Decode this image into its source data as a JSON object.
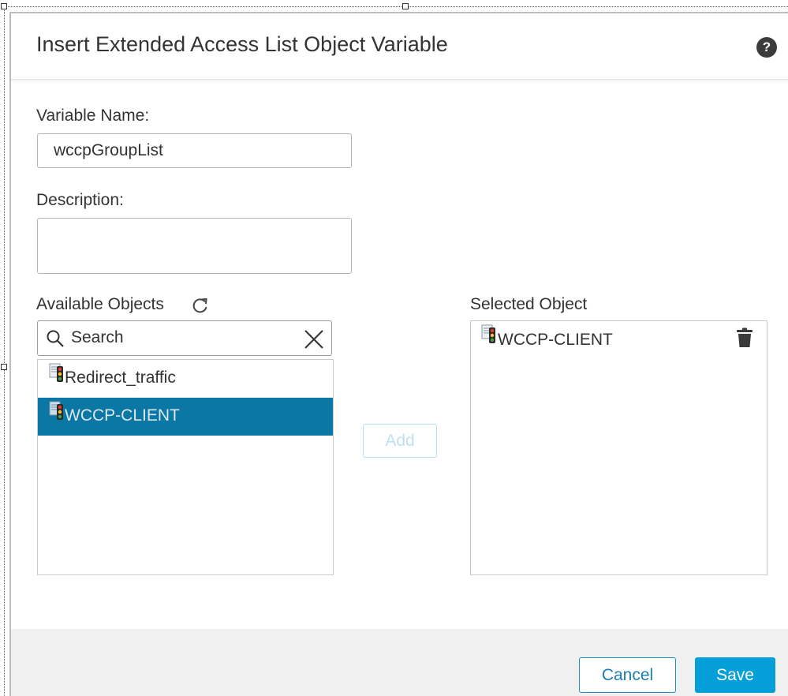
{
  "dialog": {
    "title": "Insert Extended Access List Object Variable",
    "help_icon": "question-circle-icon"
  },
  "variable_name": {
    "label": "Variable Name:",
    "value": "wccpGroupList"
  },
  "description": {
    "label": "Description:",
    "value": ""
  },
  "available_objects": {
    "label": "Available Objects",
    "refresh_icon": "refresh-icon",
    "search_placeholder": "Search",
    "items": [
      {
        "label": "Redirect_traffic",
        "icon": "extended-acl-icon",
        "selected": false
      },
      {
        "label": "WCCP-CLIENT",
        "icon": "extended-acl-icon",
        "selected": true
      }
    ]
  },
  "add_button": {
    "label": "Add",
    "enabled": false
  },
  "selected_object": {
    "label": "Selected Object",
    "items": [
      {
        "label": "WCCP-CLIENT",
        "icon": "extended-acl-icon",
        "remove_icon": "trash-icon"
      }
    ]
  },
  "footer": {
    "cancel_label": "Cancel",
    "save_label": "Save"
  },
  "colors": {
    "selected_row": "#0b77a5",
    "primary_button": "#049fd9",
    "secondary_button_border": "#1b8ec2",
    "footer_background": "#f0f0f0"
  }
}
